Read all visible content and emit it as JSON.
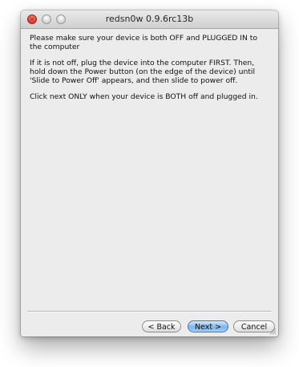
{
  "window": {
    "title": "redsn0w 0.9.6rc13b"
  },
  "instructions": {
    "line1": "Please make sure your device is both OFF and PLUGGED IN to the computer",
    "line2": "If it is not off, plug the device into the computer FIRST. Then, hold down the Power button (on the edge of the device) until 'Slide to Power Off' appears, and then slide to power off.",
    "line3": "Click next ONLY when your device is BOTH off and plugged in."
  },
  "buttons": {
    "back": "< Back",
    "next": "Next >",
    "cancel": "Cancel"
  },
  "icons": {
    "close": "close-icon",
    "minimize": "minimize-icon",
    "zoom": "zoom-icon",
    "resize": "resize-grip-icon"
  },
  "colors": {
    "close_button": "#e4453a",
    "default_button": "#7fb3ee",
    "window_background": "#ececec"
  }
}
